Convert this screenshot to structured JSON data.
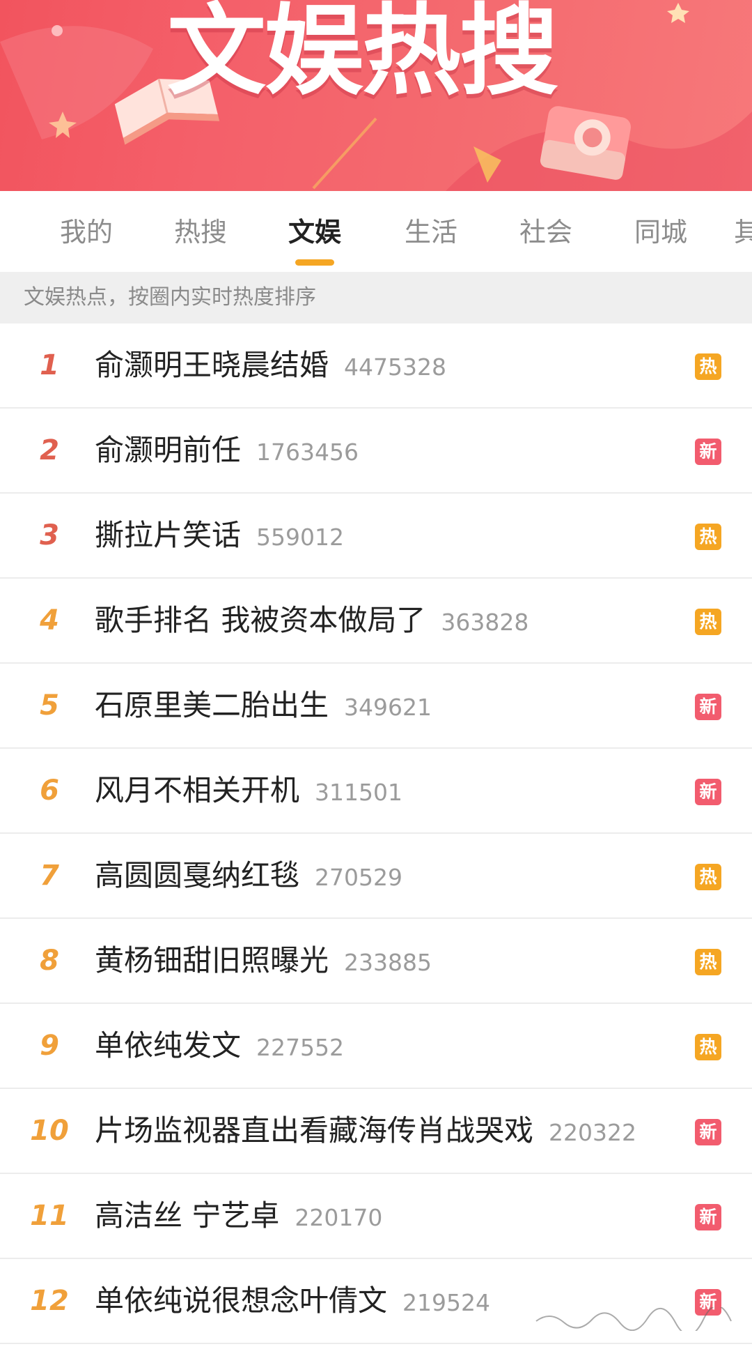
{
  "banner": {
    "title": "文娱热搜"
  },
  "tabs": [
    {
      "label": "我的",
      "active": false
    },
    {
      "label": "热搜",
      "active": false
    },
    {
      "label": "文娱",
      "active": true
    },
    {
      "label": "生活",
      "active": false
    },
    {
      "label": "社会",
      "active": false
    },
    {
      "label": "同城",
      "active": false
    },
    {
      "label": "其",
      "active": false
    }
  ],
  "subtitle": "文娱热点，按圈内实时热度排序",
  "colors": {
    "rank_top3": "#e0604f",
    "rank_other": "#f0a03a",
    "badge_hot": "#f5a623",
    "badge_new": "#f25c6e",
    "tab_underline": "#f5a623"
  },
  "items": [
    {
      "rank": "1",
      "title": "俞灏明王晓晨结婚",
      "count": "4475328",
      "badge": "热",
      "badge_type": "hot"
    },
    {
      "rank": "2",
      "title": "俞灏明前任",
      "count": "1763456",
      "badge": "新",
      "badge_type": "new"
    },
    {
      "rank": "3",
      "title": "撕拉片笑话",
      "count": "559012",
      "badge": "热",
      "badge_type": "hot"
    },
    {
      "rank": "4",
      "title": "歌手排名 我被资本做局了",
      "count": "363828",
      "badge": "热",
      "badge_type": "hot"
    },
    {
      "rank": "5",
      "title": "石原里美二胎出生",
      "count": "349621",
      "badge": "新",
      "badge_type": "new"
    },
    {
      "rank": "6",
      "title": "风月不相关开机",
      "count": "311501",
      "badge": "新",
      "badge_type": "new"
    },
    {
      "rank": "7",
      "title": "高圆圆戛纳红毯",
      "count": "270529",
      "badge": "热",
      "badge_type": "hot"
    },
    {
      "rank": "8",
      "title": "黄杨钿甜旧照曝光",
      "count": "233885",
      "badge": "热",
      "badge_type": "hot"
    },
    {
      "rank": "9",
      "title": "单依纯发文",
      "count": "227552",
      "badge": "热",
      "badge_type": "hot"
    },
    {
      "rank": "10",
      "title": "片场监视器直出看藏海传肖战哭戏",
      "count": "220322",
      "badge": "新",
      "badge_type": "new"
    },
    {
      "rank": "11",
      "title": "高洁丝 宁艺卓",
      "count": "220170",
      "badge": "新",
      "badge_type": "new"
    },
    {
      "rank": "12",
      "title": "单依纯说很想念叶倩文",
      "count": "219524",
      "badge": "新",
      "badge_type": "new"
    }
  ]
}
